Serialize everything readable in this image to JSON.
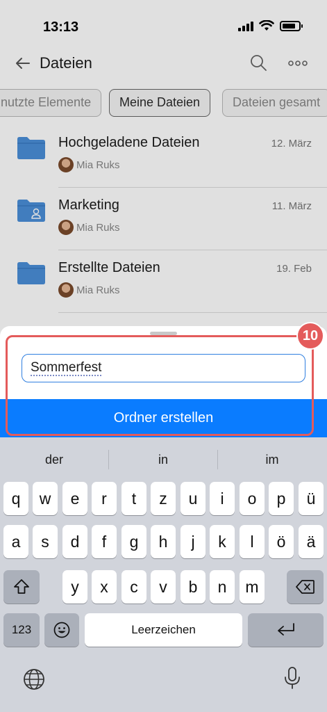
{
  "status_bar": {
    "time": "13:13"
  },
  "nav": {
    "title": "Dateien"
  },
  "chips": [
    {
      "label": "nutzte Elemente"
    },
    {
      "label": "Meine Dateien"
    },
    {
      "label": "Dateien gesamt"
    }
  ],
  "files": [
    {
      "name": "Hochgeladene Dateien",
      "date": "12. März",
      "owner": "Mia Ruks"
    },
    {
      "name": "Marketing",
      "date": "11. März",
      "owner": "Mia Ruks"
    },
    {
      "name": "Erstellte Dateien",
      "date": "19. Feb",
      "owner": "Mia Ruks"
    }
  ],
  "sheet": {
    "input_value": "Sommerfest",
    "create_button": "Ordner erstellen"
  },
  "step_badge": "10",
  "keyboard": {
    "suggestions": [
      "der",
      "in",
      "im"
    ],
    "row1": [
      "q",
      "w",
      "e",
      "r",
      "t",
      "z",
      "u",
      "i",
      "o",
      "p",
      "ü"
    ],
    "row2": [
      "a",
      "s",
      "d",
      "f",
      "g",
      "h",
      "j",
      "k",
      "l",
      "ö",
      "ä"
    ],
    "row3": [
      "y",
      "x",
      "c",
      "v",
      "b",
      "n",
      "m"
    ],
    "numbers_key": "123",
    "space_key": "Leerzeichen"
  },
  "colors": {
    "accent": "#0a7cff",
    "highlight": "#e45b5b",
    "folder": "#4a8fd9"
  }
}
